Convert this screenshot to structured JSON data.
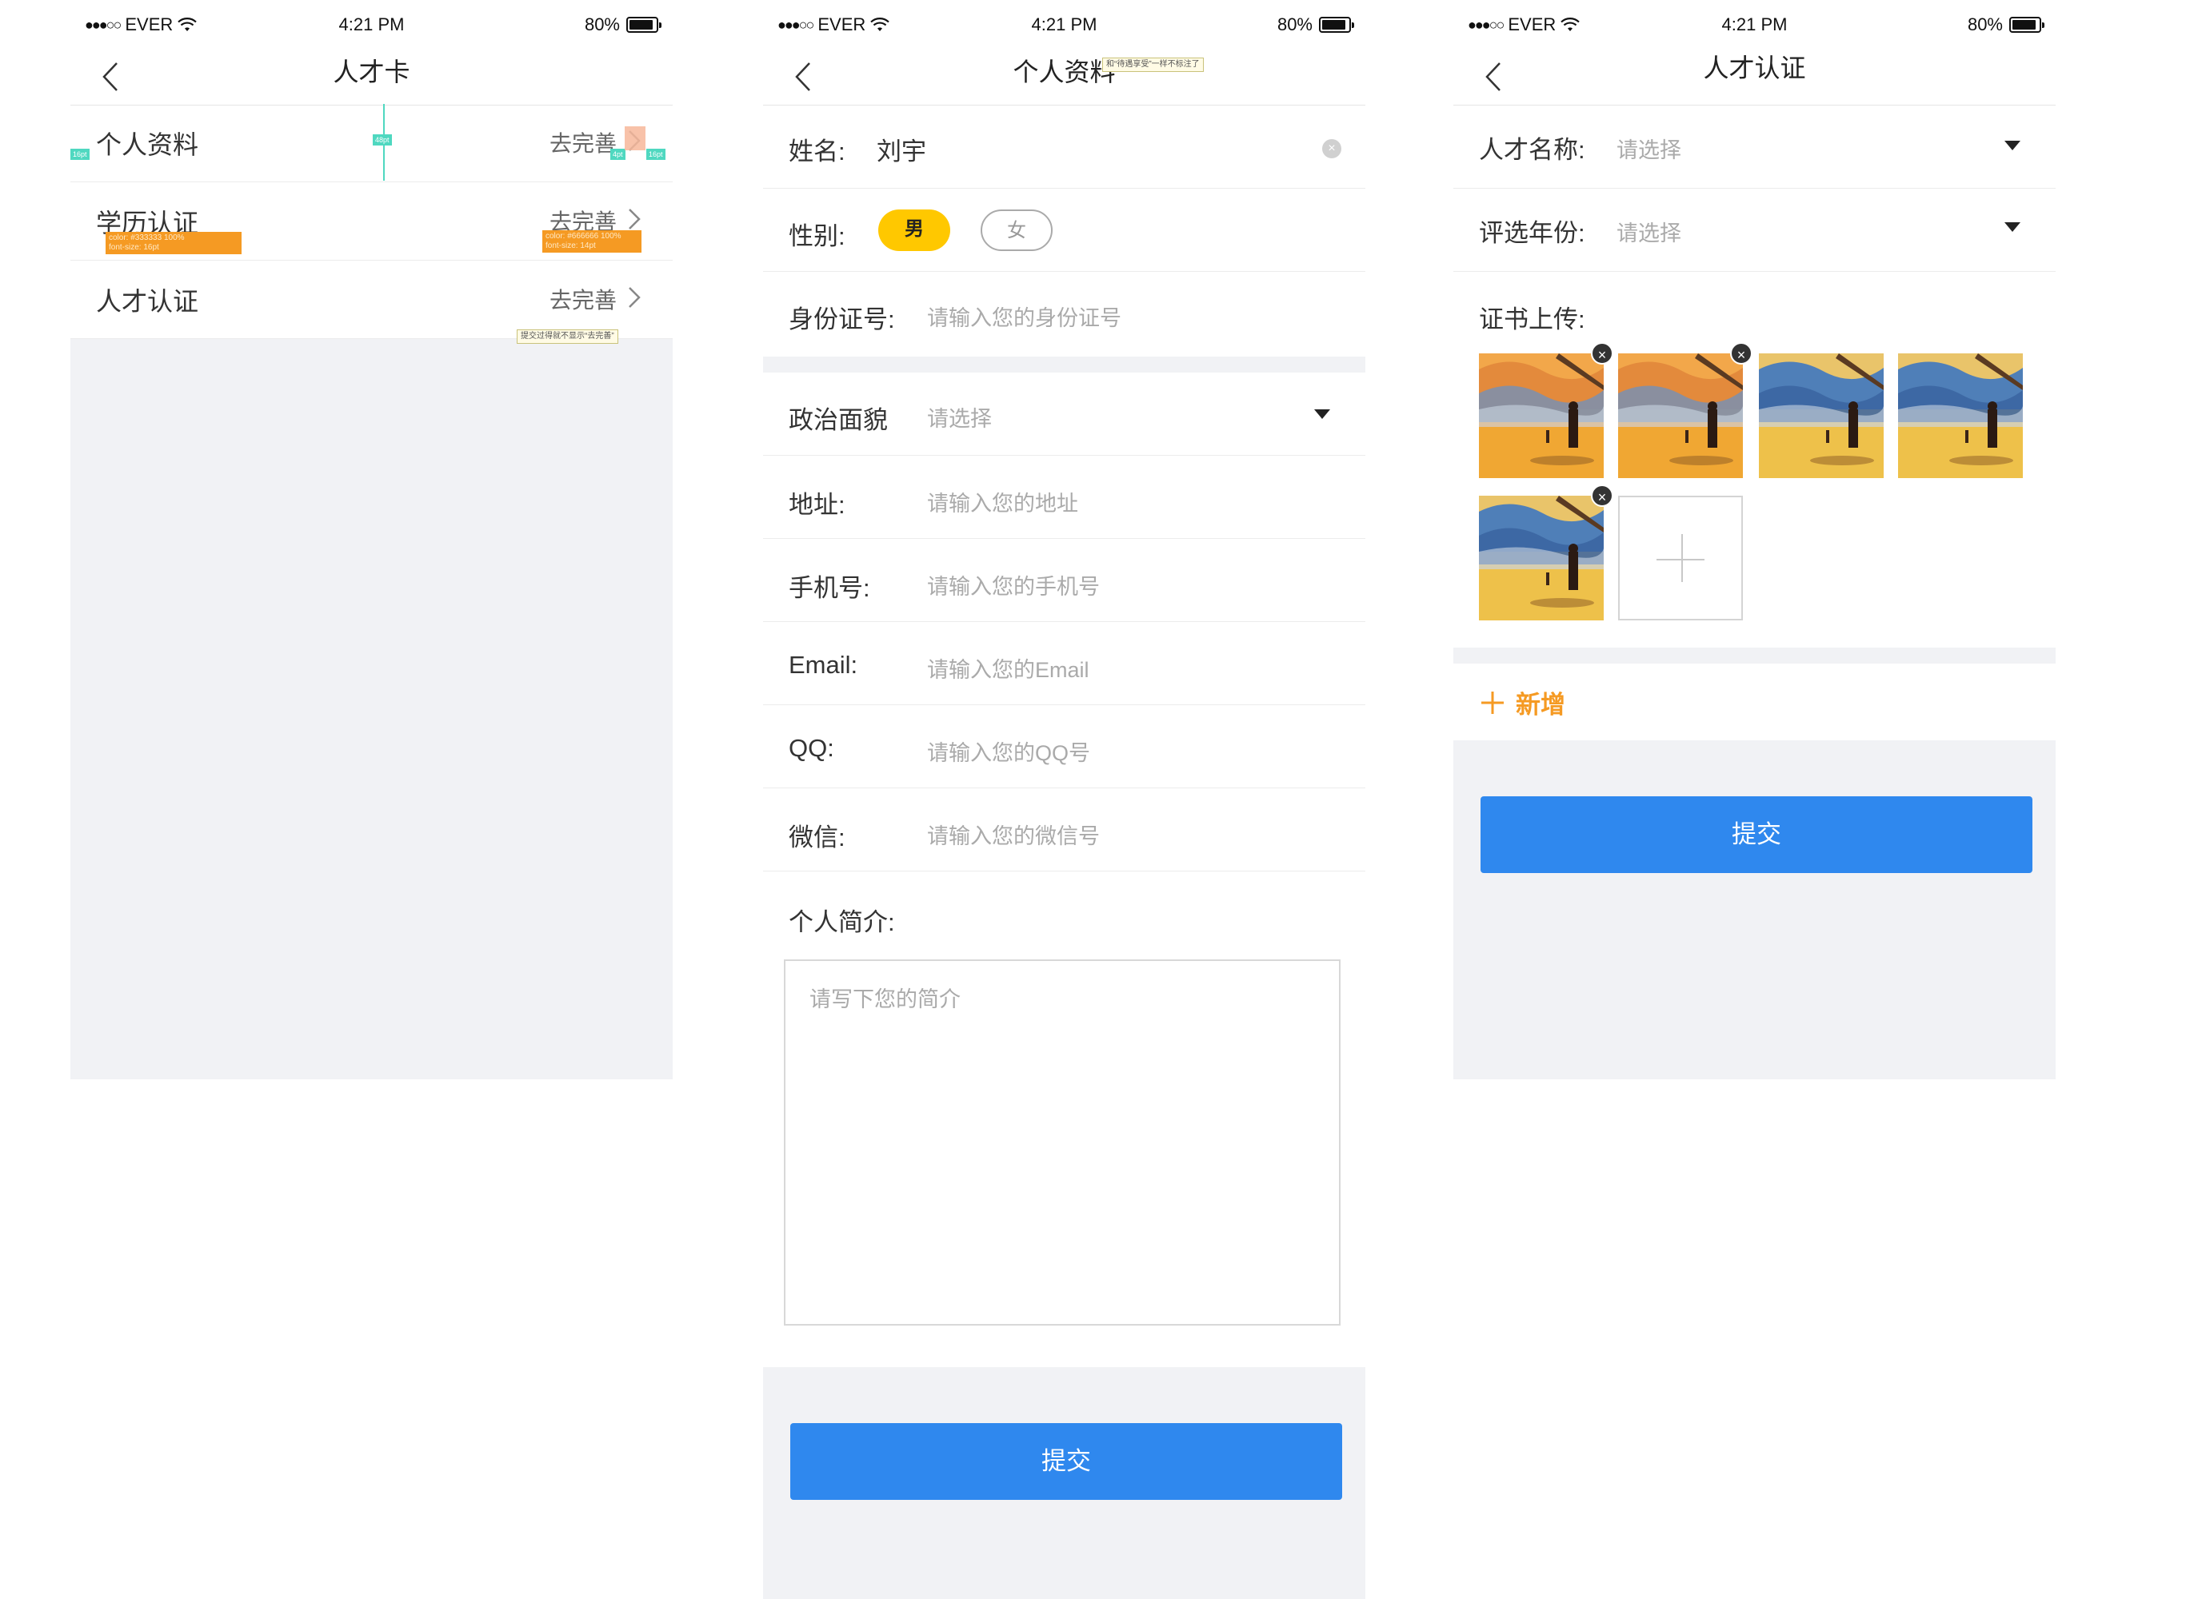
{
  "colors": {
    "accent_blue": "#2f88ee",
    "accent_yellow": "#ffc800",
    "annotation_orange": "#f59a23",
    "annotation_teal": "#4fd8c0",
    "page_gray": "#f1f2f5",
    "text_dark": "#333333",
    "text_muted": "#666666",
    "placeholder": "#aaaaaa"
  },
  "status_bar": {
    "carrier": "EVER",
    "dots": "●●●○○",
    "time": "4:21 PM",
    "battery": "80%"
  },
  "screen1": {
    "title": "人才卡",
    "rows": [
      {
        "label": "个人资料",
        "value": "去完善"
      },
      {
        "label": "学历认证",
        "value": "去完善"
      },
      {
        "label": "人才认证",
        "value": "去完善"
      }
    ],
    "annotations": {
      "label_spec": "color: #333333 100%\nfont-size: 16pt",
      "value_spec": "color: #666666 100%\nfont-size: 14pt",
      "note": "提交过得就不显示“去完善”",
      "height_tag": "48pt",
      "left_margin_tag": "16pt",
      "gap_tag": "4pt",
      "right_margin_tag": "16pt"
    }
  },
  "screen2": {
    "title": "个人资料",
    "title_note": "和“待遇享受”一样不标注了",
    "name_label": "姓名:",
    "name_value": "刘宇",
    "gender_label": "性别:",
    "gender_male": "男",
    "gender_female": "女",
    "id_label": "身份证号:",
    "id_placeholder": "请输入您的身份证号",
    "politics_label": "政治面貌",
    "politics_placeholder": "请选择",
    "address_label": "地址:",
    "address_placeholder": "请输入您的地址",
    "phone_label": "手机号:",
    "phone_placeholder": "请输入您的手机号",
    "email_label": "Email:",
    "email_placeholder": "请输入您的Email",
    "qq_label": "QQ:",
    "qq_placeholder": "请输入您的QQ号",
    "wechat_label": "微信:",
    "wechat_placeholder": "请输入您的微信号",
    "intro_label": "个人简介:",
    "intro_placeholder": "请写下您的简介",
    "submit": "提交"
  },
  "screen3": {
    "title": "人才认证",
    "talent_name_label": "人才名称:",
    "talent_name_placeholder": "请选择",
    "year_label": "评选年份:",
    "year_placeholder": "请选择",
    "upload_label": "证书上传:",
    "thumbnails": [
      {
        "removable": true,
        "tone": "orange"
      },
      {
        "removable": true,
        "tone": "orange"
      },
      {
        "removable": false,
        "tone": "blue"
      },
      {
        "removable": false,
        "tone": "blue"
      },
      {
        "removable": true,
        "tone": "blue"
      }
    ],
    "add_new": "新增",
    "submit": "提交"
  }
}
